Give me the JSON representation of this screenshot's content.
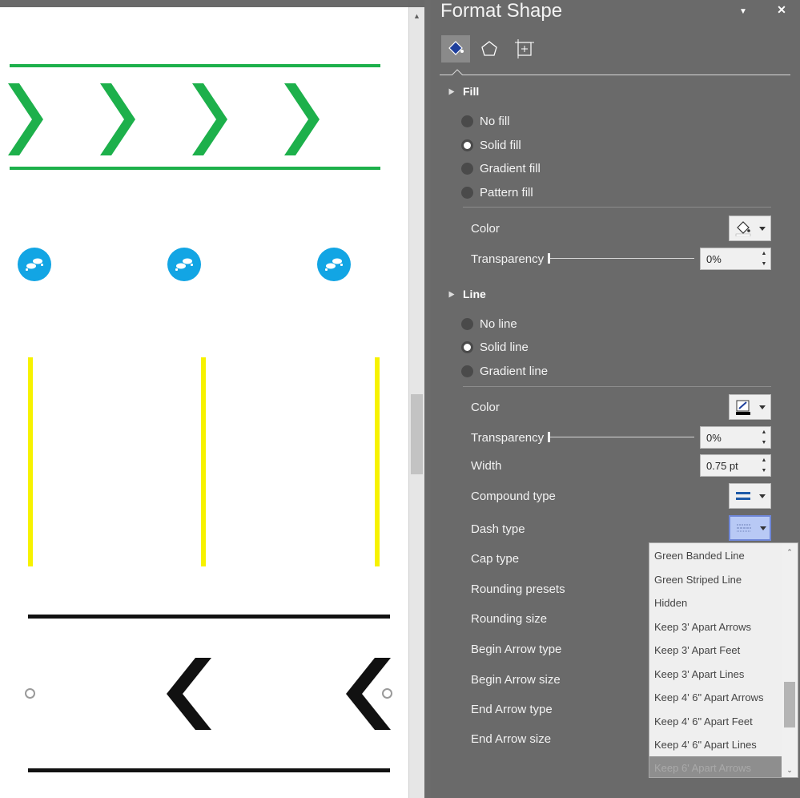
{
  "panel": {
    "title": "Format Shape",
    "menu_glyph": "▼",
    "close_glyph": "✕",
    "tabs": [
      {
        "name": "fill-line-tab",
        "icon": "paint-bucket-icon"
      },
      {
        "name": "effects-tab",
        "icon": "pentagon-icon"
      },
      {
        "name": "size-properties-tab",
        "icon": "size-properties-icon"
      }
    ]
  },
  "fill": {
    "heading": "Fill",
    "options": [
      {
        "label": "No fill",
        "selected": false
      },
      {
        "label": "Solid fill",
        "selected": true
      },
      {
        "label": "Gradient fill",
        "selected": false
      },
      {
        "label": "Pattern fill",
        "selected": false
      }
    ],
    "color_label": "Color",
    "transparency_label": "Transparency",
    "transparency_value": "0%"
  },
  "line": {
    "heading": "Line",
    "options": [
      {
        "label": "No line",
        "selected": false
      },
      {
        "label": "Solid line",
        "selected": true
      },
      {
        "label": "Gradient line",
        "selected": false
      }
    ],
    "color_label": "Color",
    "transparency_label": "Transparency",
    "transparency_value": "0%",
    "width_label": "Width",
    "width_value": "0.75 pt",
    "compound_label": "Compound type",
    "dash_label": "Dash type",
    "cap_label": "Cap type",
    "rounding_presets_label": "Rounding presets",
    "rounding_size_label": "Rounding size",
    "begin_arrow_type_label": "Begin Arrow type",
    "begin_arrow_size_label": "Begin Arrow size",
    "end_arrow_type_label": "End Arrow type",
    "end_arrow_size_label": "End Arrow size"
  },
  "dash_dropdown": {
    "items": [
      "Green Banded Line",
      "Green Striped Line",
      "Hidden",
      "Keep 3' Apart Arrows",
      "Keep 3' Apart Feet",
      "Keep 3' Apart Lines",
      "Keep 4' 6\" Apart Arrows",
      "Keep 4' 6\" Apart Feet",
      "Keep 4' 6\" Apart Lines",
      "Keep 6' Apart Arrows"
    ],
    "highlighted_index": 9
  },
  "colors": {
    "green": "#1db04b",
    "blue": "#12a5e4",
    "yellow": "#f7f200",
    "black": "#111111",
    "panel_bg": "#6a6a6a"
  }
}
